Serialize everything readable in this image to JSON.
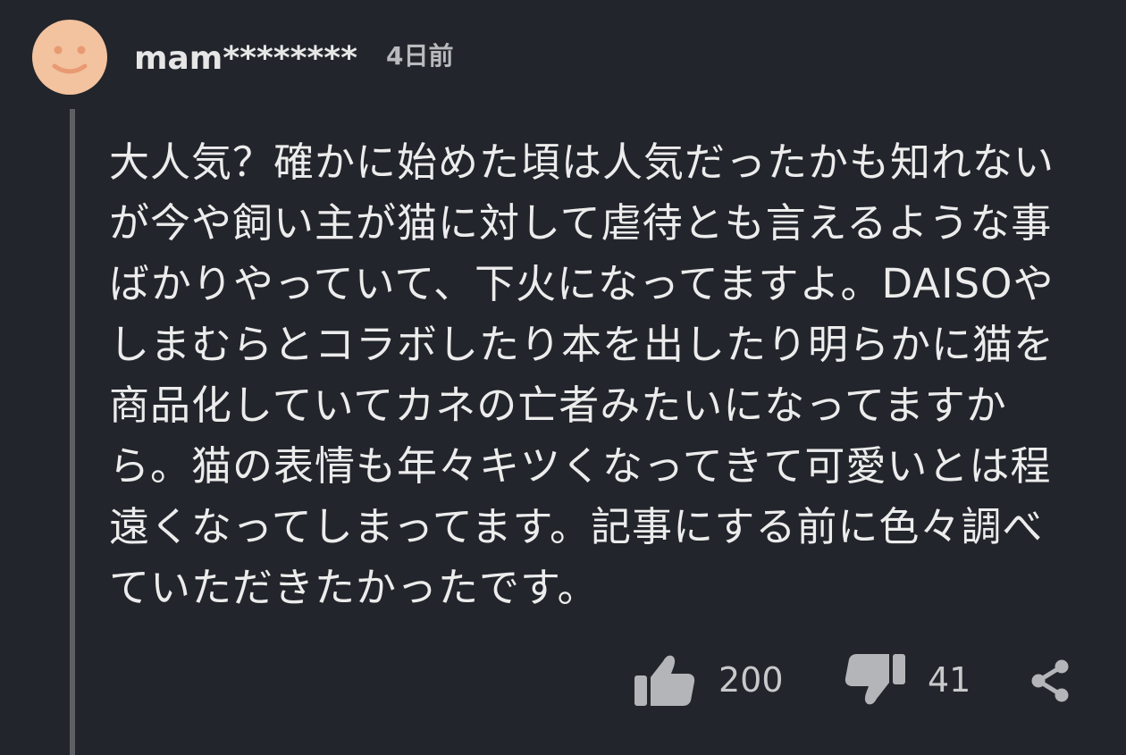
{
  "comment": {
    "username": "mam********",
    "time": "4日前",
    "body_lines": [
      "大人気？確かに始めた頃は人気だったかも知れない",
      "が今や飼い主が猫に対して虐待とも言えるような事",
      "ばかりやっていて、下火になってますよ。DAISOや",
      "しまむらとコラボしたり本を出したり明らかに猫を",
      "商品化していてカネの亡者みたいになってますか",
      "ら。猫の表情も年々キツくなってきて可愛いとは程",
      "遠くなってしまってます。記事にする前に色々調べ",
      "ていただきたかったです。"
    ],
    "likes": "200",
    "dislikes": "41"
  },
  "icons": {
    "avatar": "smiley-face-icon",
    "like": "thumbs-up-icon",
    "dislike": "thumbs-down-icon",
    "share": "share-icon"
  },
  "colors": {
    "background": "#22252b",
    "avatar": "#f3c29e",
    "avatar_face": "#e89a72",
    "icon": "#b3b5b8"
  }
}
